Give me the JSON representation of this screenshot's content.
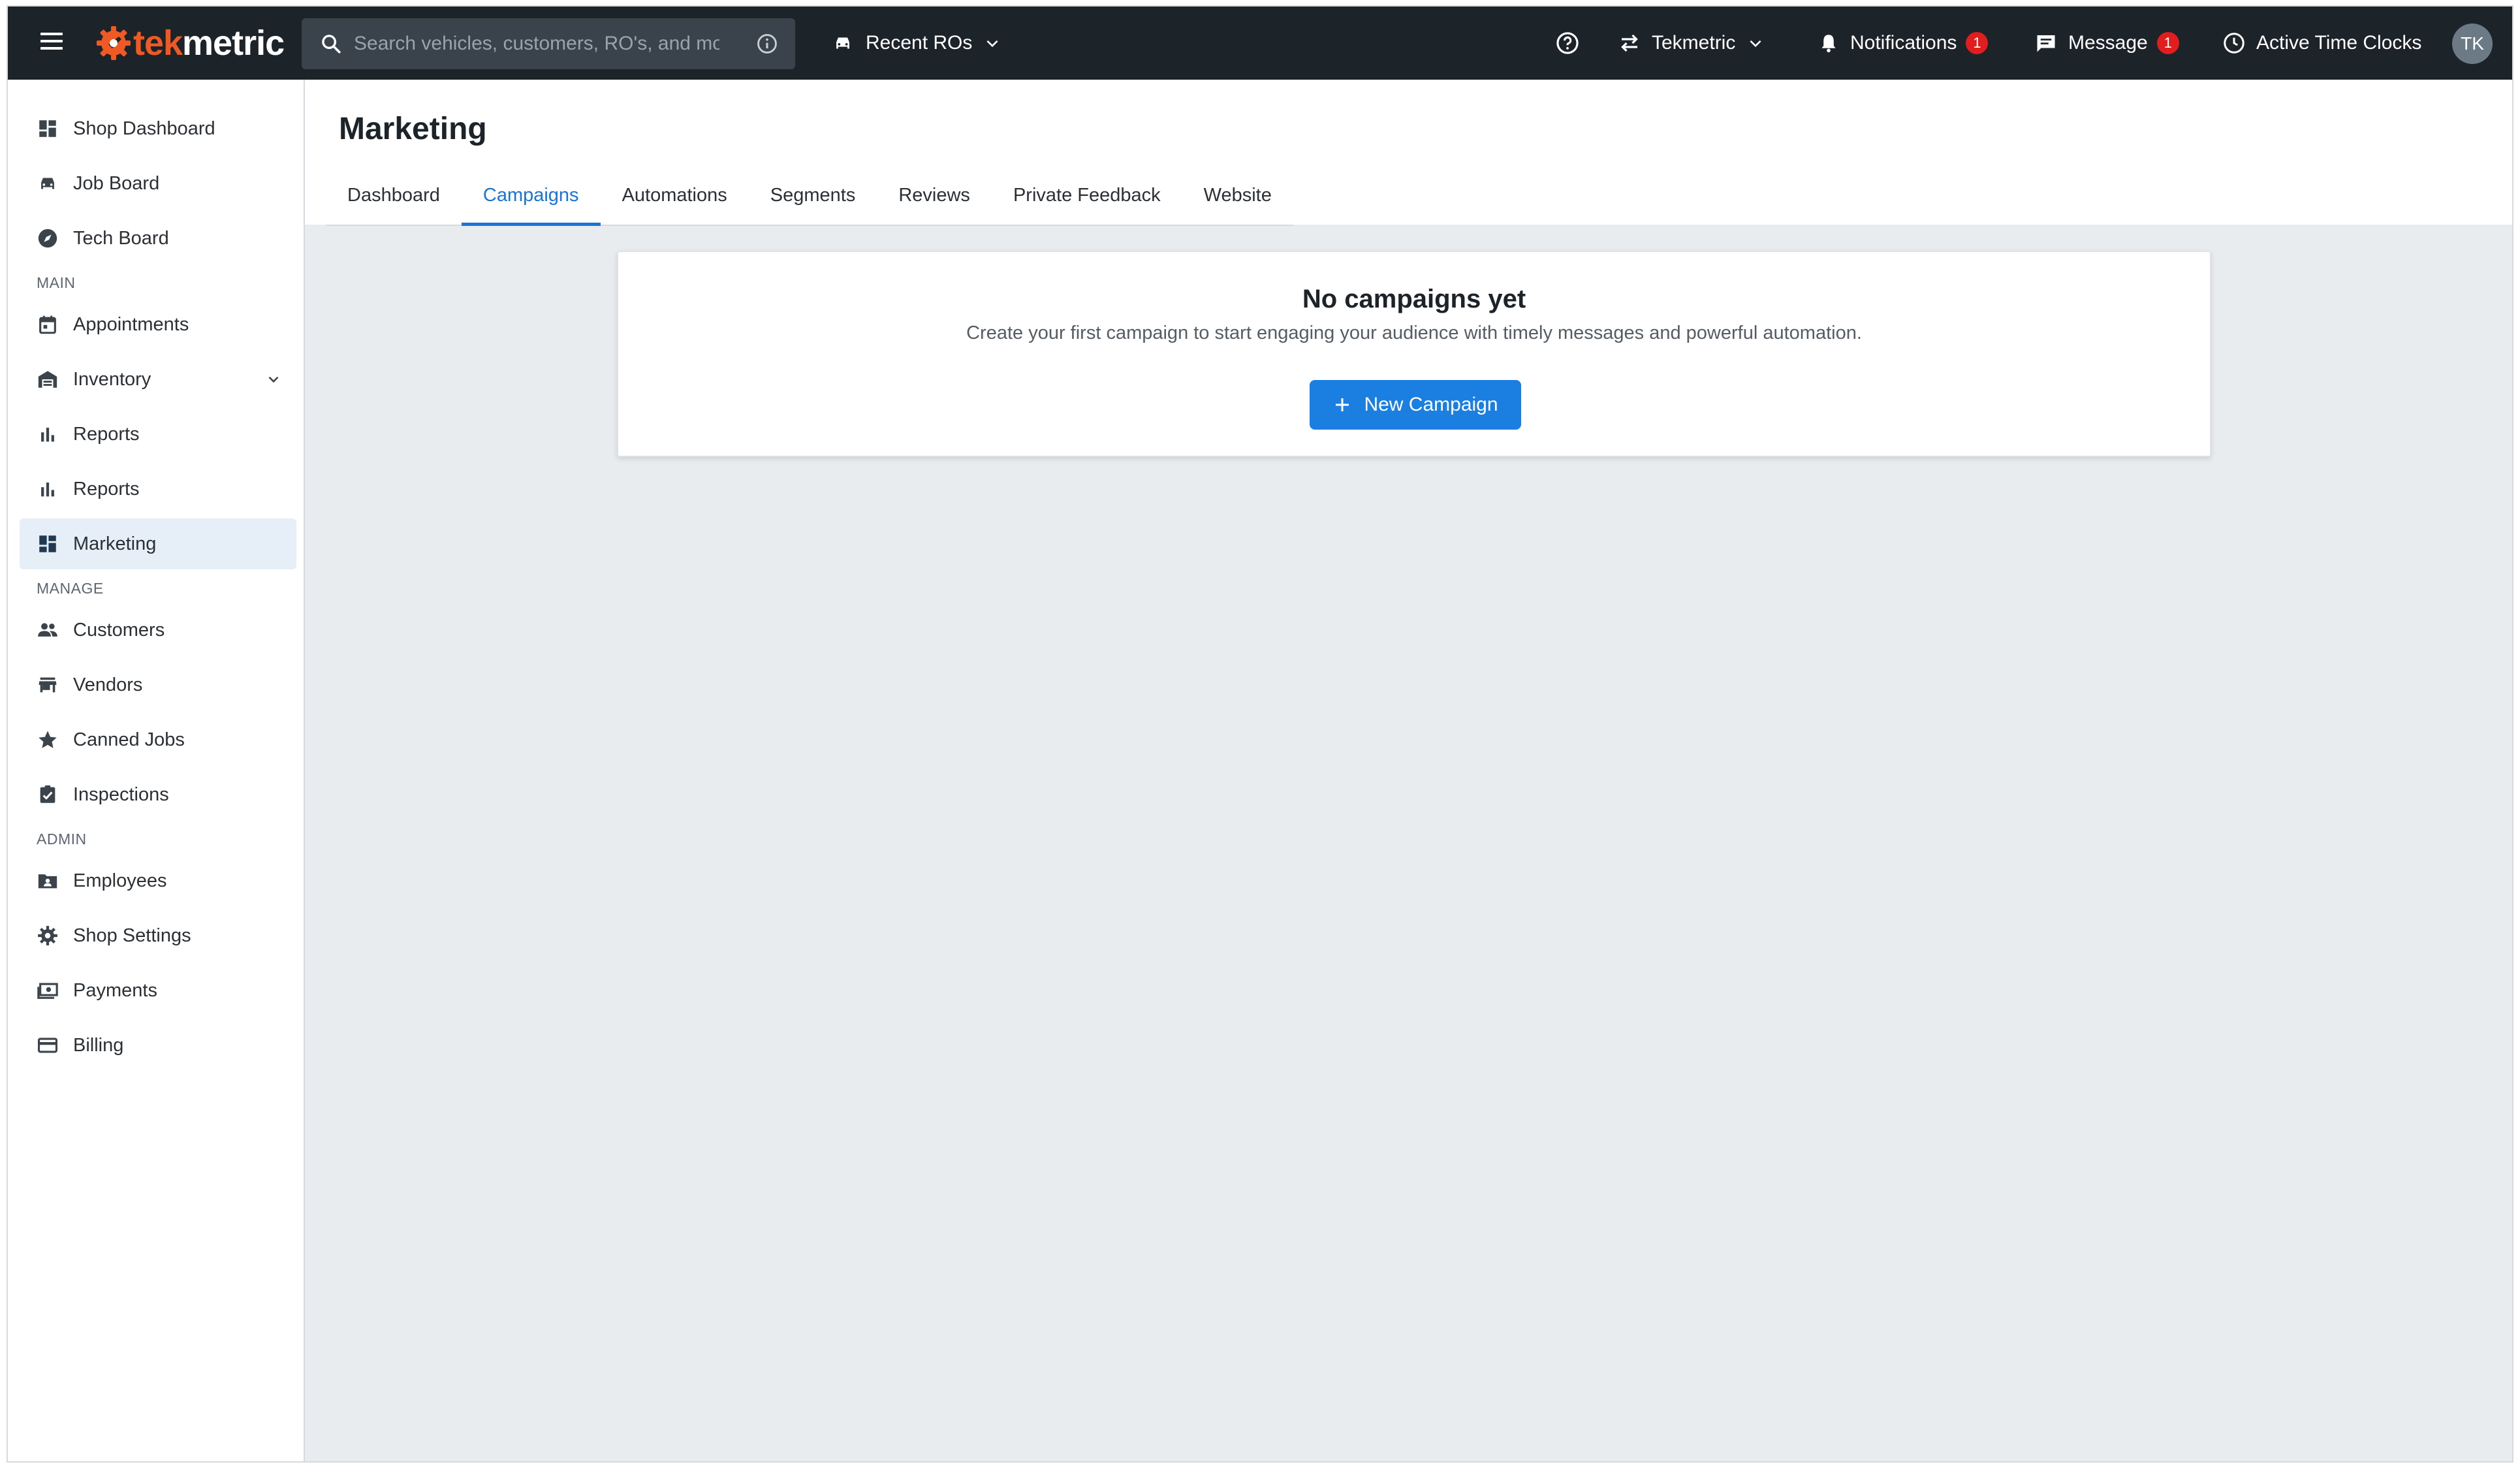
{
  "topbar": {
    "logo": {
      "part1": "tek",
      "part2": "metric"
    },
    "search": {
      "placeholder": "Search vehicles, customers, RO's, and more..."
    },
    "recent_ros": "Recent ROs",
    "shop_switcher": "Tekmetric",
    "notifications": {
      "label": "Notifications",
      "count": "1"
    },
    "messages": {
      "label": "Message",
      "count": "1"
    },
    "time_clocks": "Active Time Clocks",
    "avatar_initials": "TK"
  },
  "sidebar": {
    "top_items": [
      {
        "label": "Shop Dashboard",
        "icon": "dashboard-icon"
      },
      {
        "label": "Job Board",
        "icon": "car-icon"
      },
      {
        "label": "Tech Board",
        "icon": "compass-icon"
      }
    ],
    "main_section": "MAIN",
    "main_items": [
      {
        "label": "Appointments",
        "icon": "calendar-icon"
      },
      {
        "label": "Inventory",
        "icon": "warehouse-icon"
      },
      {
        "label": "Reports",
        "icon": "bar-chart-icon"
      },
      {
        "label": "Reports",
        "icon": "bar-chart-icon"
      },
      {
        "label": "Marketing",
        "icon": "dashboard-icon",
        "active": true
      }
    ],
    "manage_section": "MANAGE",
    "manage_items": [
      {
        "label": "Customers",
        "icon": "people-icon"
      },
      {
        "label": "Vendors",
        "icon": "store-icon"
      },
      {
        "label": "Canned Jobs",
        "icon": "star-icon"
      },
      {
        "label": "Inspections",
        "icon": "clipboard-check-icon"
      }
    ],
    "admin_section": "ADMIN",
    "admin_items": [
      {
        "label": "Employees",
        "icon": "contact-folder-icon"
      },
      {
        "label": "Shop Settings",
        "icon": "gear-icon"
      },
      {
        "label": "Payments",
        "icon": "money-icon"
      },
      {
        "label": "Billing",
        "icon": "credit-card-icon"
      }
    ]
  },
  "page": {
    "title": "Marketing",
    "tabs": [
      "Dashboard",
      "Campaigns",
      "Automations",
      "Segments",
      "Reviews",
      "Private Feedback",
      "Website"
    ],
    "active_tab": "Campaigns"
  },
  "empty_state": {
    "title": "No campaigns yet",
    "description": "Create your first campaign to start engaging your audience with timely messages and powerful automation.",
    "button": "New Campaign"
  },
  "colors": {
    "topbar": "#1c2329",
    "accent": "#1a7fe0",
    "brand_orange": "#ef5a24",
    "badge": "#e11d1d",
    "content_bg": "#e9ecef"
  }
}
